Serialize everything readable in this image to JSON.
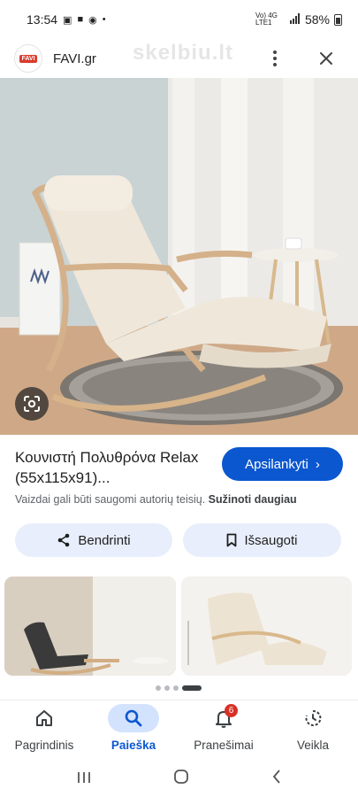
{
  "status_bar": {
    "time": "13:54",
    "network": "Vo) 4G LTE1",
    "battery": "58%"
  },
  "source": {
    "favicon_text": "FAVI",
    "site_name": "FAVI.gr",
    "watermark": "skelbiu.lt"
  },
  "result": {
    "title": "Κουνιστή Πολυθρόνα Relax (55x115x91)...",
    "visit_label": "Apsilankyti",
    "visit_chevron": "›",
    "copyright": "Vaizdai gali būti saugomi autorių teisių.",
    "learn_more": "Sužinoti daugiau"
  },
  "actions": {
    "share_label": "Bendrinti",
    "save_label": "Išsaugoti"
  },
  "colors": {
    "accent": "#0b57d0",
    "chip_bg": "#e8eefb",
    "nav_active_bg": "#d3e3fd",
    "badge": "#d93025"
  },
  "pager": {
    "count": 4,
    "active_index": 3
  },
  "nav": {
    "items": [
      {
        "label": "Pagrindinis",
        "icon": "home-icon"
      },
      {
        "label": "Paieška",
        "icon": "search-icon",
        "active": true
      },
      {
        "label": "Pranešimai",
        "icon": "bell-icon",
        "badge": "6"
      },
      {
        "label": "Veikla",
        "icon": "activity-icon"
      }
    ]
  }
}
